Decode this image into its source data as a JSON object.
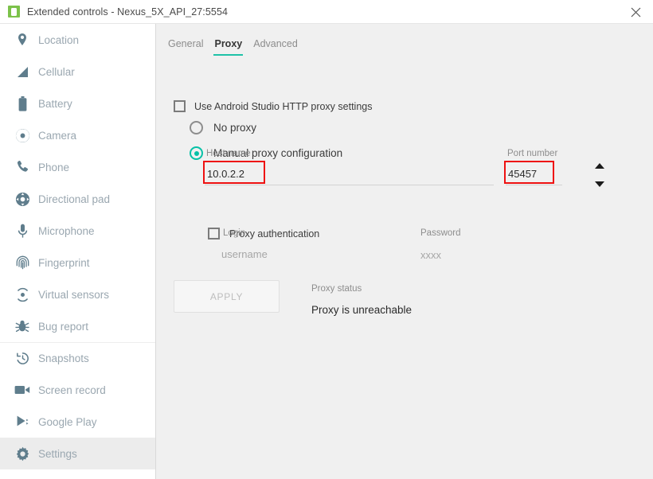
{
  "window": {
    "title": "Extended controls - Nexus_5X_API_27:5554",
    "app_icon": "android-emulator-icon",
    "close_label": "close-icon"
  },
  "sidebar": {
    "items": [
      {
        "label": "Location",
        "icon": "location-pin-icon",
        "selected": false,
        "divider_above": false
      },
      {
        "label": "Cellular",
        "icon": "cellular-signal-icon",
        "selected": false,
        "divider_above": false
      },
      {
        "label": "Battery",
        "icon": "battery-icon",
        "selected": false,
        "divider_above": false
      },
      {
        "label": "Camera",
        "icon": "camera-aperture-icon",
        "selected": false,
        "divider_above": false
      },
      {
        "label": "Phone",
        "icon": "phone-handset-icon",
        "selected": false,
        "divider_above": false
      },
      {
        "label": "Directional pad",
        "icon": "directional-pad-icon",
        "selected": false,
        "divider_above": false
      },
      {
        "label": "Microphone",
        "icon": "microphone-icon",
        "selected": false,
        "divider_above": false
      },
      {
        "label": "Fingerprint",
        "icon": "fingerprint-icon",
        "selected": false,
        "divider_above": false
      },
      {
        "label": "Virtual sensors",
        "icon": "virtual-sensors-icon",
        "selected": false,
        "divider_above": false
      },
      {
        "label": "Bug report",
        "icon": "bug-icon",
        "selected": false,
        "divider_above": false
      },
      {
        "label": "Snapshots",
        "icon": "snapshot-clock-icon",
        "selected": false,
        "divider_above": true
      },
      {
        "label": "Screen record",
        "icon": "video-camera-icon",
        "selected": false,
        "divider_above": false
      },
      {
        "label": "Google Play",
        "icon": "google-play-icon",
        "selected": false,
        "divider_above": false
      },
      {
        "label": "Settings",
        "icon": "gear-icon",
        "selected": true,
        "divider_above": false
      }
    ]
  },
  "tabs": [
    {
      "label": "General",
      "active": false
    },
    {
      "label": "Proxy",
      "active": true
    },
    {
      "label": "Advanced",
      "active": false
    }
  ],
  "proxy": {
    "use_android_studio_label": "Use Android Studio HTTP proxy settings",
    "use_android_studio_checked": false,
    "no_proxy_label": "No proxy",
    "no_proxy_selected": false,
    "manual_label": "Manual proxy configuration",
    "manual_selected": true,
    "host_name_label": "Host name",
    "host_name_value": "10.0.2.2",
    "port_number_label": "Port number",
    "port_number_value": "45457",
    "authentication_label": "Proxy authentication",
    "authentication_checked": false,
    "login_label": "Login",
    "login_value": "username",
    "password_label": "Password",
    "password_value": "xxxx",
    "apply_label": "APPLY",
    "status_label": "Proxy status",
    "status_value": "Proxy is unreachable"
  },
  "colors": {
    "accent": "#06c1a7",
    "annotation": "#ee1111",
    "content_bg": "#f0f0f0",
    "sidebar_text": "#9aa7b0"
  }
}
